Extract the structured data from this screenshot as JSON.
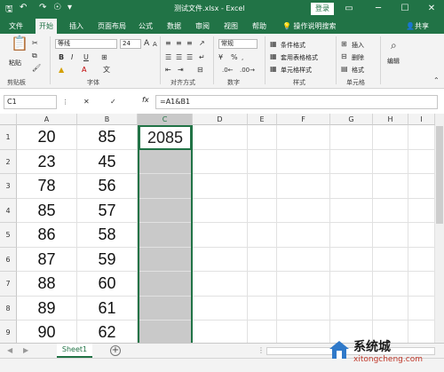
{
  "window": {
    "title": "测试文件.xlsx  -  Excel",
    "login": "登录",
    "colors": {
      "brand": "#217346",
      "selection": "#c9c9c9"
    }
  },
  "tabs": [
    "文件",
    "开始",
    "插入",
    "页面布局",
    "公式",
    "数据",
    "审阅",
    "视图",
    "帮助"
  ],
  "active_tab": "开始",
  "tell_me": "操作说明搜索",
  "share": "共享",
  "ribbon": {
    "paste": "粘贴",
    "clipboard": "剪贴板",
    "font_name": "等线",
    "font_size": "24",
    "font_group": "字体",
    "align_group": "对齐方式",
    "number_format": "常规",
    "percent": "%",
    "number_group": "数字",
    "cond_format": "条件格式",
    "table_format": "套用表格格式",
    "cell_style": "单元格样式",
    "style_group": "样式",
    "insert": "插入",
    "delete": "删除",
    "format": "格式",
    "cells_group": "单元格",
    "edit": "编辑"
  },
  "formula_bar": {
    "name_box": "C1",
    "fx": "fx",
    "formula": "=A1&B1"
  },
  "sheet": {
    "columns": [
      "A",
      "B",
      "C",
      "D",
      "E",
      "F",
      "G",
      "H",
      "I"
    ],
    "rows": [
      "1",
      "2",
      "3",
      "4",
      "5",
      "6",
      "7",
      "8",
      "9",
      "10"
    ],
    "col_a": [
      "20",
      "23",
      "78",
      "85",
      "86",
      "87",
      "88",
      "89",
      "90"
    ],
    "col_b": [
      "85",
      "45",
      "56",
      "57",
      "58",
      "59",
      "60",
      "61",
      "62"
    ],
    "c1": "2085",
    "selected_column": "C"
  },
  "sheet_tab": "Sheet1",
  "watermark": {
    "name": "系统城",
    "url": "xitongcheng.com"
  }
}
